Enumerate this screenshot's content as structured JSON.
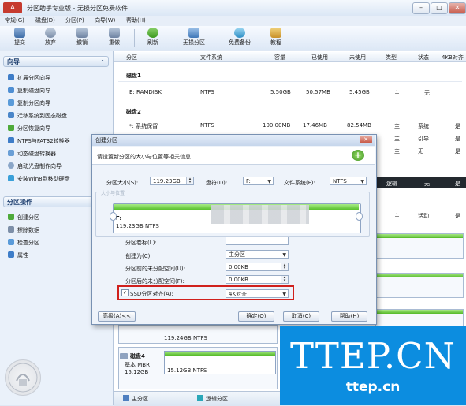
{
  "window": {
    "title": "分区助手专业版 - 无损分区免费软件",
    "logo_text": "A",
    "controls": [
      "–",
      "□",
      "✕"
    ]
  },
  "menu": [
    "常规(G)",
    "磁盘(D)",
    "分区(P)",
    "向导(W)",
    "帮助(H)"
  ],
  "toolbar": {
    "buttons": [
      {
        "label": "提交",
        "icon": "commit-icon"
      },
      {
        "label": "放弃",
        "icon": "discard-icon"
      },
      {
        "label": "撤销",
        "icon": "undo-icon"
      },
      {
        "label": "重做",
        "icon": "redo-icon"
      },
      {
        "label": "刷新",
        "icon": "refresh-icon"
      },
      {
        "label": "无损分区",
        "icon": "partition-icon"
      },
      {
        "label": "免费备份",
        "icon": "backup-icon"
      },
      {
        "label": "教程",
        "icon": "tutorial-icon"
      }
    ]
  },
  "sidebar": {
    "wizard_title": "向导",
    "wizard_items": [
      "扩展分区向导",
      "复制磁盘向导",
      "复制分区向导",
      "迁移系统到固态磁盘",
      "分区恢复向导",
      "NTFS与FAT32转换器",
      "动态磁盘转换器",
      "启动光盘制作向导",
      "安装Win8到移动硬盘"
    ],
    "ops_title": "分区操作",
    "ops_items": [
      "创建分区",
      "擦除数据",
      "检查分区",
      "属性"
    ]
  },
  "table": {
    "headers": [
      "分区",
      "文件系统",
      "容量",
      "已使用",
      "未使用",
      "类型",
      "状态",
      "4KB对齐"
    ],
    "disk1_label": "磁盘1",
    "disk1_rows": [
      {
        "name": "E: RAMDISK",
        "fs": "NTFS",
        "capacity": "5.50GB",
        "used": "50.57MB",
        "free": "5.45GB",
        "type": "主",
        "status": "无",
        "align": ""
      }
    ],
    "disk2_label": "磁盘2",
    "disk2_rows": [
      {
        "name": "*: 系统保留",
        "fs": "NTFS",
        "capacity": "100.00MB",
        "used": "17.46MB",
        "free": "82.54MB",
        "type": "主",
        "status": "系统",
        "align": "是"
      },
      {
        "name": "",
        "fs": "",
        "capacity": "",
        "used": "",
        "free": "",
        "type": "主",
        "status": "引导",
        "align": "是"
      },
      {
        "name": "",
        "fs": "",
        "capacity": "",
        "used": "",
        "free": "",
        "type": "主",
        "status": "无",
        "align": "是"
      }
    ],
    "right_col_rows": [
      {
        "type": "逻辑",
        "status": "无",
        "align": "是"
      },
      {
        "type": "主",
        "status": "活动",
        "align": "是"
      }
    ]
  },
  "dialog": {
    "title": "创建分区",
    "description": "请设置新分区的大小与位置等相关信息.",
    "size_label": "分区大小(S):",
    "size_value": "119.23GB",
    "drive_label": "盘符(D):",
    "drive_value": "F:",
    "fs_label": "文件系统(F):",
    "fs_value": "NTFS",
    "group_legend": "大小与位置",
    "bar_name": "F:",
    "bar_info": "119.23GB NTFS",
    "volume_label": "分区卷标(L):",
    "volume_value": "",
    "create_as_label": "创建为(C):",
    "create_as_value": "主分区",
    "before_label": "分区前的未分配空间(U):",
    "before_value": "0.00KB",
    "after_label": "分区后的未分配空间(F):",
    "after_value": "0.00KB",
    "ssd_label": "SSD分区对齐(A):",
    "ssd_checked": "✓",
    "ssd_value": "4K对齐",
    "advanced_button": "高级(A)<<",
    "ok_button": "确定(O)",
    "cancel_button": "取消(C)",
    "help_button": "帮助(H)"
  },
  "diskmap": {
    "disk4_name": "磁盘4",
    "disk4_type": "基本 MBR",
    "disk4_size": "15.12GB",
    "disk4_partition": "15.12GB NTFS",
    "disk3_partition": "119.24GB NTFS"
  },
  "legend": {
    "primary": "主分区",
    "logical": "逻辑分区",
    "unallocated": "未分配空间"
  },
  "watermark": {
    "title": "TTEP.CN",
    "url": "ttep.cn"
  },
  "colors": {
    "partition_green": "#59c12e",
    "highlight_red": "#d0201c",
    "watermark_blue": "#0c8de0"
  }
}
